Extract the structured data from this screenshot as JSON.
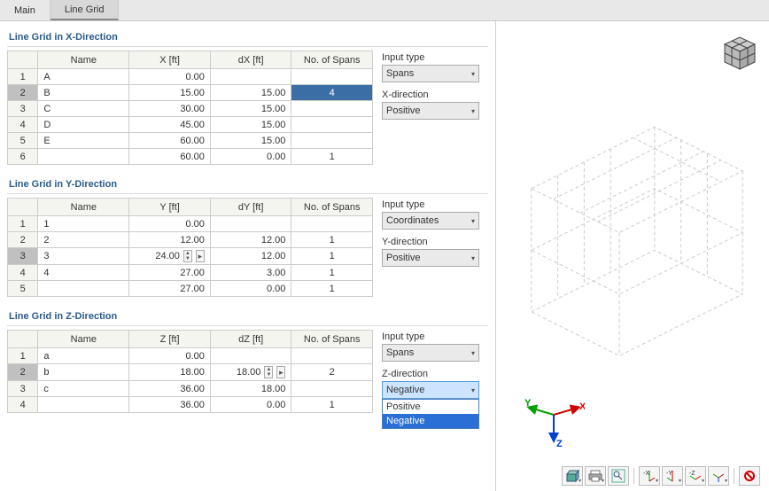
{
  "tabs": {
    "main": "Main",
    "linegrid": "Line Grid"
  },
  "sections": {
    "x": {
      "title": "Line Grid in X-Direction",
      "headers": {
        "blank": "",
        "name": "Name",
        "coord": "X [ft]",
        "delta": "dX [ft]",
        "spans": "No. of Spans"
      },
      "rows": [
        {
          "idx": "1",
          "name": "A",
          "coord": "0.00",
          "delta": "",
          "spans": ""
        },
        {
          "idx": "2",
          "name": "B",
          "coord": "15.00",
          "delta": "15.00",
          "spans": "4"
        },
        {
          "idx": "3",
          "name": "C",
          "coord": "30.00",
          "delta": "15.00",
          "spans": ""
        },
        {
          "idx": "4",
          "name": "D",
          "coord": "45.00",
          "delta": "15.00",
          "spans": ""
        },
        {
          "idx": "5",
          "name": "E",
          "coord": "60.00",
          "delta": "15.00",
          "spans": ""
        },
        {
          "idx": "6",
          "name": "",
          "coord": "60.00",
          "delta": "0.00",
          "spans": "1"
        }
      ],
      "ctrl": {
        "input_label": "Input type",
        "input_val": "Spans",
        "dir_label": "X-direction",
        "dir_val": "Positive"
      }
    },
    "y": {
      "title": "Line Grid in Y-Direction",
      "headers": {
        "blank": "",
        "name": "Name",
        "coord": "Y [ft]",
        "delta": "dY [ft]",
        "spans": "No. of Spans"
      },
      "rows": [
        {
          "idx": "1",
          "name": "1",
          "coord": "0.00",
          "delta": "",
          "spans": ""
        },
        {
          "idx": "2",
          "name": "2",
          "coord": "12.00",
          "delta": "12.00",
          "spans": "1"
        },
        {
          "idx": "3",
          "name": "3",
          "coord": "24.00",
          "delta": "12.00",
          "spans": "1"
        },
        {
          "idx": "4",
          "name": "4",
          "coord": "27.00",
          "delta": "3.00",
          "spans": "1"
        },
        {
          "idx": "5",
          "name": "",
          "coord": "27.00",
          "delta": "0.00",
          "spans": "1"
        }
      ],
      "ctrl": {
        "input_label": "Input type",
        "input_val": "Coordinates",
        "dir_label": "Y-direction",
        "dir_val": "Positive"
      }
    },
    "z": {
      "title": "Line Grid in Z-Direction",
      "headers": {
        "blank": "",
        "name": "Name",
        "coord": "Z [ft]",
        "delta": "dZ [ft]",
        "spans": "No. of Spans"
      },
      "rows": [
        {
          "idx": "1",
          "name": "a",
          "coord": "0.00",
          "delta": "",
          "spans": ""
        },
        {
          "idx": "2",
          "name": "b",
          "coord": "18.00",
          "delta": "18.00",
          "spans": "2"
        },
        {
          "idx": "3",
          "name": "c",
          "coord": "36.00",
          "delta": "18.00",
          "spans": ""
        },
        {
          "idx": "4",
          "name": "",
          "coord": "36.00",
          "delta": "0.00",
          "spans": "1"
        }
      ],
      "ctrl": {
        "input_label": "Input type",
        "input_val": "Spans",
        "dir_label": "Z-direction",
        "dir_val": "Negative",
        "options": [
          "Positive",
          "Negative"
        ]
      }
    }
  },
  "axis": {
    "x": "X",
    "y": "Y",
    "z": "Z"
  }
}
